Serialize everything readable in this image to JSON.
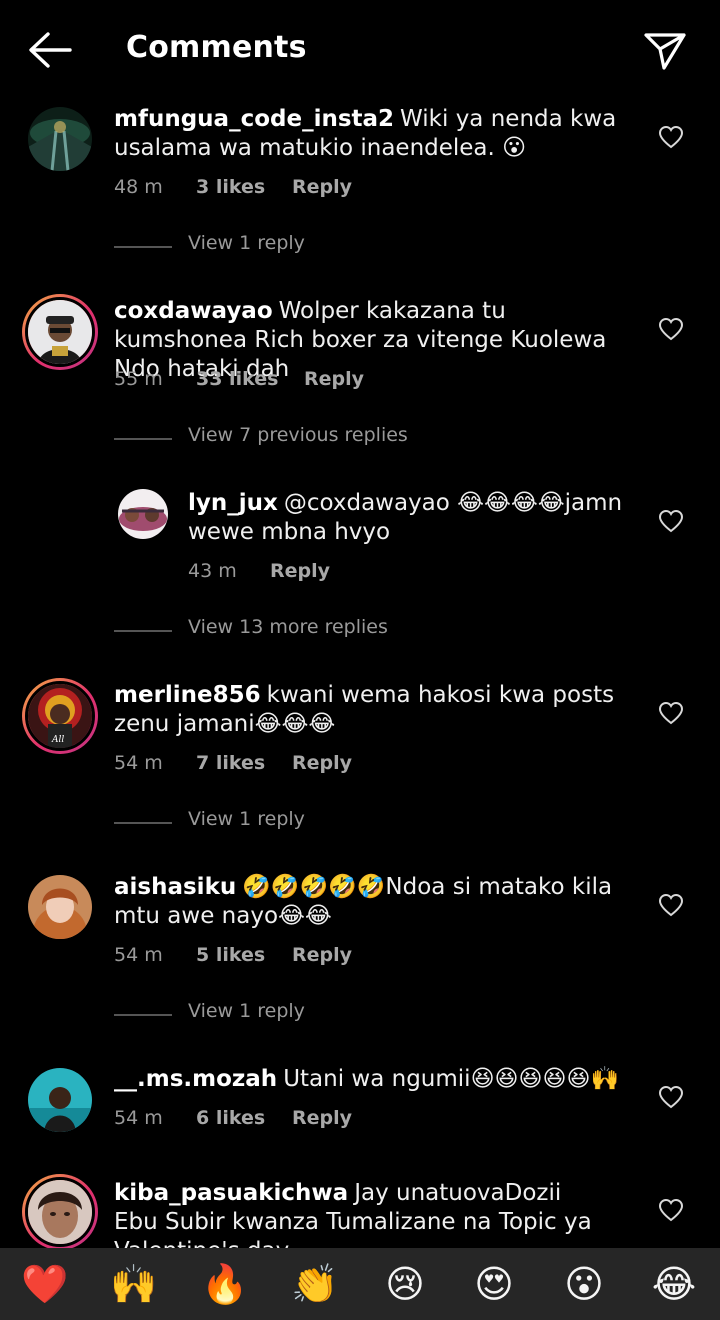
{
  "header": {
    "title": "Comments"
  },
  "comments": [
    {
      "username": "mfungua_code_insta2",
      "text": "Wiki ya nenda kwa usalama wa matukio inaendelea. 😮",
      "time": "48 m",
      "likes": "3 likes",
      "reply": "Reply",
      "view": "View 1 reply"
    },
    {
      "username": "coxdawayao",
      "text": "Wolper kakazana tu kumshonea Rich boxer za vitenge Kuolewa Ndo hataki dah",
      "time": "55 m",
      "likes": "33 likes",
      "reply": "Reply",
      "view": "View 7 previous replies"
    },
    {
      "username": "lyn_jux",
      "text": "@coxdawayao 😂😂😂😂jamn wewe mbna hvyo",
      "time": "43 m",
      "reply": "Reply",
      "view": "View 13 more replies"
    },
    {
      "username": "merline856",
      "text": "kwani wema hakosi kwa posts zenu jamani😂😂😂",
      "time": "54 m",
      "likes": "7 likes",
      "reply": "Reply",
      "view": "View 1 reply"
    },
    {
      "username": "aishasiku",
      "text": "🤣🤣🤣🤣🤣Ndoa si matako kila mtu awe nayo😂😂",
      "time": "54 m",
      "likes": "5 likes",
      "reply": "Reply",
      "view": "View 1 reply"
    },
    {
      "username": "__.ms.mozah",
      "text": "Utani wa ngumii😆😆😆😆😆🙌",
      "time": "54 m",
      "likes": "6 likes",
      "reply": "Reply"
    },
    {
      "username": "kiba_pasuakichwa",
      "text": "Jay unatuovaDozii Ebu Subir kwanza Tumalizane na Topic ya Valentine's day"
    }
  ],
  "emoji_bar": [
    "❤️",
    "🙌",
    "🔥",
    "👏",
    "😢",
    "😍",
    "😮",
    "😂"
  ]
}
